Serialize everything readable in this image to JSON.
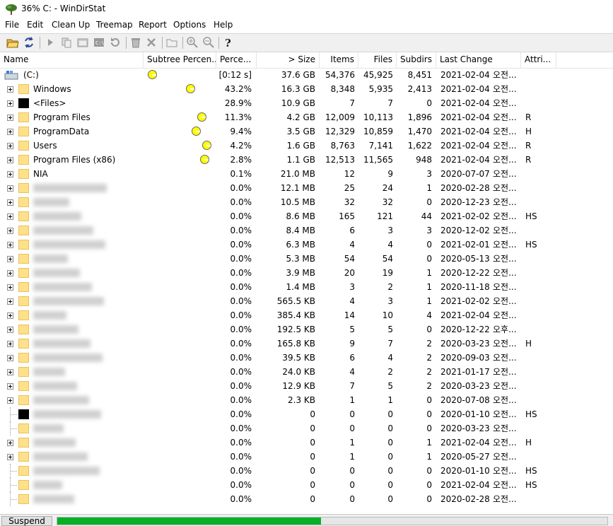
{
  "window": {
    "title": "36% C: - WinDirStat"
  },
  "menu": [
    "File",
    "Edit",
    "Clean Up",
    "Treemap",
    "Report",
    "Options",
    "Help"
  ],
  "toolbar": {
    "icons": [
      "open-icon",
      "refresh-icon",
      "run-icon",
      "copy-icon",
      "explorer-icon",
      "cmd-icon",
      "refresh-selected-icon",
      "delete-bin-icon",
      "delete-icon",
      "new-folder-icon",
      "zoom-in-icon",
      "zoom-out-icon",
      "help-icon"
    ]
  },
  "columns": [
    "Name",
    "Subtree Percen...",
    "Perce...",
    "> Size",
    "Items",
    "Files",
    "Subdirs",
    "Last Change",
    "Attri..."
  ],
  "rows": [
    {
      "name": "(C:)",
      "pct": "[0:12 s]",
      "size": "37.6 GB",
      "items": "54,376",
      "files": "45,925",
      "subdirs": "8,451",
      "date": "2021-02-04",
      "time": "오전...",
      "attr": "",
      "type": "drive",
      "expand": false,
      "blur": false,
      "pac": true
    },
    {
      "name": "Windows",
      "pct": "43.2%",
      "size": "16.3 GB",
      "items": "8,348",
      "files": "5,935",
      "subdirs": "2,413",
      "date": "2021-02-04",
      "time": "오전...",
      "attr": "",
      "type": "folder",
      "expand": true,
      "blur": false,
      "pac": true
    },
    {
      "name": "<Files>",
      "pct": "28.9%",
      "size": "10.9 GB",
      "items": "7",
      "files": "7",
      "subdirs": "0",
      "date": "2021-02-04",
      "time": "오전...",
      "attr": "",
      "type": "files",
      "expand": true,
      "blur": false,
      "pac": false
    },
    {
      "name": "Program Files",
      "pct": "11.3%",
      "size": "4.2 GB",
      "items": "12,009",
      "files": "10,113",
      "subdirs": "1,896",
      "date": "2021-02-04",
      "time": "오전...",
      "attr": "R",
      "type": "folder",
      "expand": true,
      "blur": false,
      "pac": true
    },
    {
      "name": "ProgramData",
      "pct": "9.4%",
      "size": "3.5 GB",
      "items": "12,329",
      "files": "10,859",
      "subdirs": "1,470",
      "date": "2021-02-04",
      "time": "오전...",
      "attr": "H",
      "type": "folder",
      "expand": true,
      "blur": false,
      "pac": true
    },
    {
      "name": "Users",
      "pct": "4.2%",
      "size": "1.6 GB",
      "items": "8,763",
      "files": "7,141",
      "subdirs": "1,622",
      "date": "2021-02-04",
      "time": "오전...",
      "attr": "R",
      "type": "folder",
      "expand": true,
      "blur": false,
      "pac": true
    },
    {
      "name": "Program Files (x86)",
      "pct": "2.8%",
      "size": "1.1 GB",
      "items": "12,513",
      "files": "11,565",
      "subdirs": "948",
      "date": "2021-02-04",
      "time": "오전...",
      "attr": "R",
      "type": "folder",
      "expand": true,
      "blur": false,
      "pac": true
    },
    {
      "name": "NIA",
      "pct": "0.1%",
      "size": "21.0 MB",
      "items": "12",
      "files": "9",
      "subdirs": "3",
      "date": "2020-07-07",
      "time": "오전...",
      "attr": "",
      "type": "folder",
      "expand": true,
      "blur": false,
      "pac": false
    },
    {
      "name": "",
      "pct": "0.0%",
      "size": "12.1 MB",
      "items": "25",
      "files": "24",
      "subdirs": "1",
      "date": "2020-02-28",
      "time": "오전...",
      "attr": "",
      "type": "folder",
      "expand": true,
      "blur": true,
      "pac": false
    },
    {
      "name": "",
      "pct": "0.0%",
      "size": "10.5 MB",
      "items": "32",
      "files": "32",
      "subdirs": "0",
      "date": "2020-12-23",
      "time": "오전...",
      "attr": "",
      "type": "folder",
      "expand": true,
      "blur": true,
      "pac": false
    },
    {
      "name": "",
      "pct": "0.0%",
      "size": "8.6 MB",
      "items": "165",
      "files": "121",
      "subdirs": "44",
      "date": "2021-02-02",
      "time": "오전...",
      "attr": "HS",
      "type": "folder",
      "expand": true,
      "blur": true,
      "pac": false
    },
    {
      "name": "",
      "pct": "0.0%",
      "size": "8.4 MB",
      "items": "6",
      "files": "3",
      "subdirs": "3",
      "date": "2020-12-02",
      "time": "오전...",
      "attr": "",
      "type": "folder",
      "expand": true,
      "blur": true,
      "pac": false
    },
    {
      "name": "",
      "pct": "0.0%",
      "size": "6.3 MB",
      "items": "4",
      "files": "4",
      "subdirs": "0",
      "date": "2021-02-01",
      "time": "오전...",
      "attr": "HS",
      "type": "folder",
      "expand": true,
      "blur": true,
      "pac": false
    },
    {
      "name": "",
      "pct": "0.0%",
      "size": "5.3 MB",
      "items": "54",
      "files": "54",
      "subdirs": "0",
      "date": "2020-05-13",
      "time": "오전...",
      "attr": "",
      "type": "folder",
      "expand": true,
      "blur": true,
      "pac": false
    },
    {
      "name": "",
      "pct": "0.0%",
      "size": "3.9 MB",
      "items": "20",
      "files": "19",
      "subdirs": "1",
      "date": "2020-12-22",
      "time": "오전...",
      "attr": "",
      "type": "folder",
      "expand": true,
      "blur": true,
      "pac": false
    },
    {
      "name": "",
      "pct": "0.0%",
      "size": "1.4 MB",
      "items": "3",
      "files": "2",
      "subdirs": "1",
      "date": "2020-11-18",
      "time": "오전...",
      "attr": "",
      "type": "folder",
      "expand": true,
      "blur": true,
      "pac": false
    },
    {
      "name": "",
      "pct": "0.0%",
      "size": "565.5 KB",
      "items": "4",
      "files": "3",
      "subdirs": "1",
      "date": "2021-02-02",
      "time": "오전...",
      "attr": "",
      "type": "folder",
      "expand": true,
      "blur": true,
      "pac": false
    },
    {
      "name": "",
      "pct": "0.0%",
      "size": "385.4 KB",
      "items": "14",
      "files": "10",
      "subdirs": "4",
      "date": "2021-02-04",
      "time": "오전...",
      "attr": "",
      "type": "folder",
      "expand": true,
      "blur": true,
      "pac": false
    },
    {
      "name": "",
      "pct": "0.0%",
      "size": "192.5 KB",
      "items": "5",
      "files": "5",
      "subdirs": "0",
      "date": "2020-12-22",
      "time": "오후...",
      "attr": "",
      "type": "folder",
      "expand": true,
      "blur": true,
      "pac": false
    },
    {
      "name": "",
      "pct": "0.0%",
      "size": "165.8 KB",
      "items": "9",
      "files": "7",
      "subdirs": "2",
      "date": "2020-03-23",
      "time": "오전...",
      "attr": "H",
      "type": "folder",
      "expand": true,
      "blur": true,
      "pac": false
    },
    {
      "name": "",
      "pct": "0.0%",
      "size": "39.5 KB",
      "items": "6",
      "files": "4",
      "subdirs": "2",
      "date": "2020-09-03",
      "time": "오전...",
      "attr": "",
      "type": "folder",
      "expand": true,
      "blur": true,
      "pac": false
    },
    {
      "name": "",
      "pct": "0.0%",
      "size": "24.0 KB",
      "items": "4",
      "files": "2",
      "subdirs": "2",
      "date": "2021-01-17",
      "time": "오전...",
      "attr": "",
      "type": "folder",
      "expand": true,
      "blur": true,
      "pac": false
    },
    {
      "name": "",
      "pct": "0.0%",
      "size": "12.9 KB",
      "items": "7",
      "files": "5",
      "subdirs": "2",
      "date": "2020-03-23",
      "time": "오전...",
      "attr": "",
      "type": "folder",
      "expand": true,
      "blur": true,
      "pac": false
    },
    {
      "name": "",
      "pct": "0.0%",
      "size": "2.3 KB",
      "items": "1",
      "files": "1",
      "subdirs": "0",
      "date": "2020-07-08",
      "time": "오전...",
      "attr": "",
      "type": "folder",
      "expand": true,
      "blur": true,
      "pac": false
    },
    {
      "name": "",
      "pct": "0.0%",
      "size": "0",
      "items": "0",
      "files": "0",
      "subdirs": "0",
      "date": "2020-01-10",
      "time": "오전...",
      "attr": "HS",
      "type": "files",
      "expand": false,
      "blur": true,
      "pac": false
    },
    {
      "name": "",
      "pct": "0.0%",
      "size": "0",
      "items": "0",
      "files": "0",
      "subdirs": "0",
      "date": "2020-03-23",
      "time": "오전...",
      "attr": "",
      "type": "folder",
      "expand": false,
      "blur": true,
      "pac": false
    },
    {
      "name": "",
      "pct": "0.0%",
      "size": "0",
      "items": "1",
      "files": "0",
      "subdirs": "1",
      "date": "2021-02-04",
      "time": "오전...",
      "attr": "H",
      "type": "folder",
      "expand": true,
      "blur": true,
      "pac": false
    },
    {
      "name": "",
      "pct": "0.0%",
      "size": "0",
      "items": "1",
      "files": "0",
      "subdirs": "1",
      "date": "2020-05-27",
      "time": "오전...",
      "attr": "",
      "type": "folder",
      "expand": true,
      "blur": true,
      "pac": false
    },
    {
      "name": "",
      "pct": "0.0%",
      "size": "0",
      "items": "0",
      "files": "0",
      "subdirs": "0",
      "date": "2020-01-10",
      "time": "오전...",
      "attr": "HS",
      "type": "folder",
      "expand": false,
      "blur": true,
      "pac": false
    },
    {
      "name": "",
      "pct": "0.0%",
      "size": "0",
      "items": "0",
      "files": "0",
      "subdirs": "0",
      "date": "2021-02-04",
      "time": "오전...",
      "attr": "HS",
      "type": "folder",
      "expand": false,
      "blur": true,
      "pac": false
    },
    {
      "name": "",
      "pct": "0.0%",
      "size": "0",
      "items": "0",
      "files": "0",
      "subdirs": "0",
      "date": "2020-02-28",
      "time": "오전...",
      "attr": "",
      "type": "folder",
      "expand": false,
      "blur": true,
      "pac": false
    }
  ],
  "status": {
    "suspend_label": "Suspend",
    "progress_fraction": 0.48,
    "progress_color": "#06b025"
  },
  "colors": {
    "folder": "#ffe08a",
    "pacman": "#ffff00",
    "tree_lines": "#a0a0a0"
  }
}
